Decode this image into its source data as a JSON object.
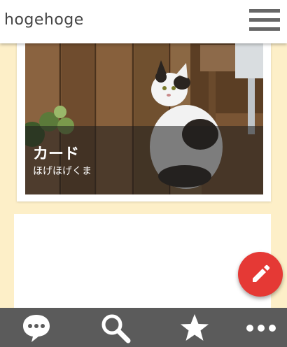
{
  "app_bar": {
    "title": "hogehoge",
    "menu_icon": "hamburger-menu-icon"
  },
  "cards": [
    {
      "title": "カード",
      "subtitle": "ほげほげくま",
      "image": "cat-photo"
    }
  ],
  "fab": {
    "icon": "pencil-icon",
    "color": "#e53935"
  },
  "bottom_nav": {
    "items": [
      {
        "icon": "chat-bubble-icon"
      },
      {
        "icon": "search-icon"
      },
      {
        "icon": "star-icon"
      },
      {
        "icon": "more-horizontal-icon"
      }
    ]
  },
  "colors": {
    "background": "#fdefc8",
    "app_bar": "#ffffff",
    "bottom_nav": "#5b5b5b",
    "accent": "#e53935"
  }
}
